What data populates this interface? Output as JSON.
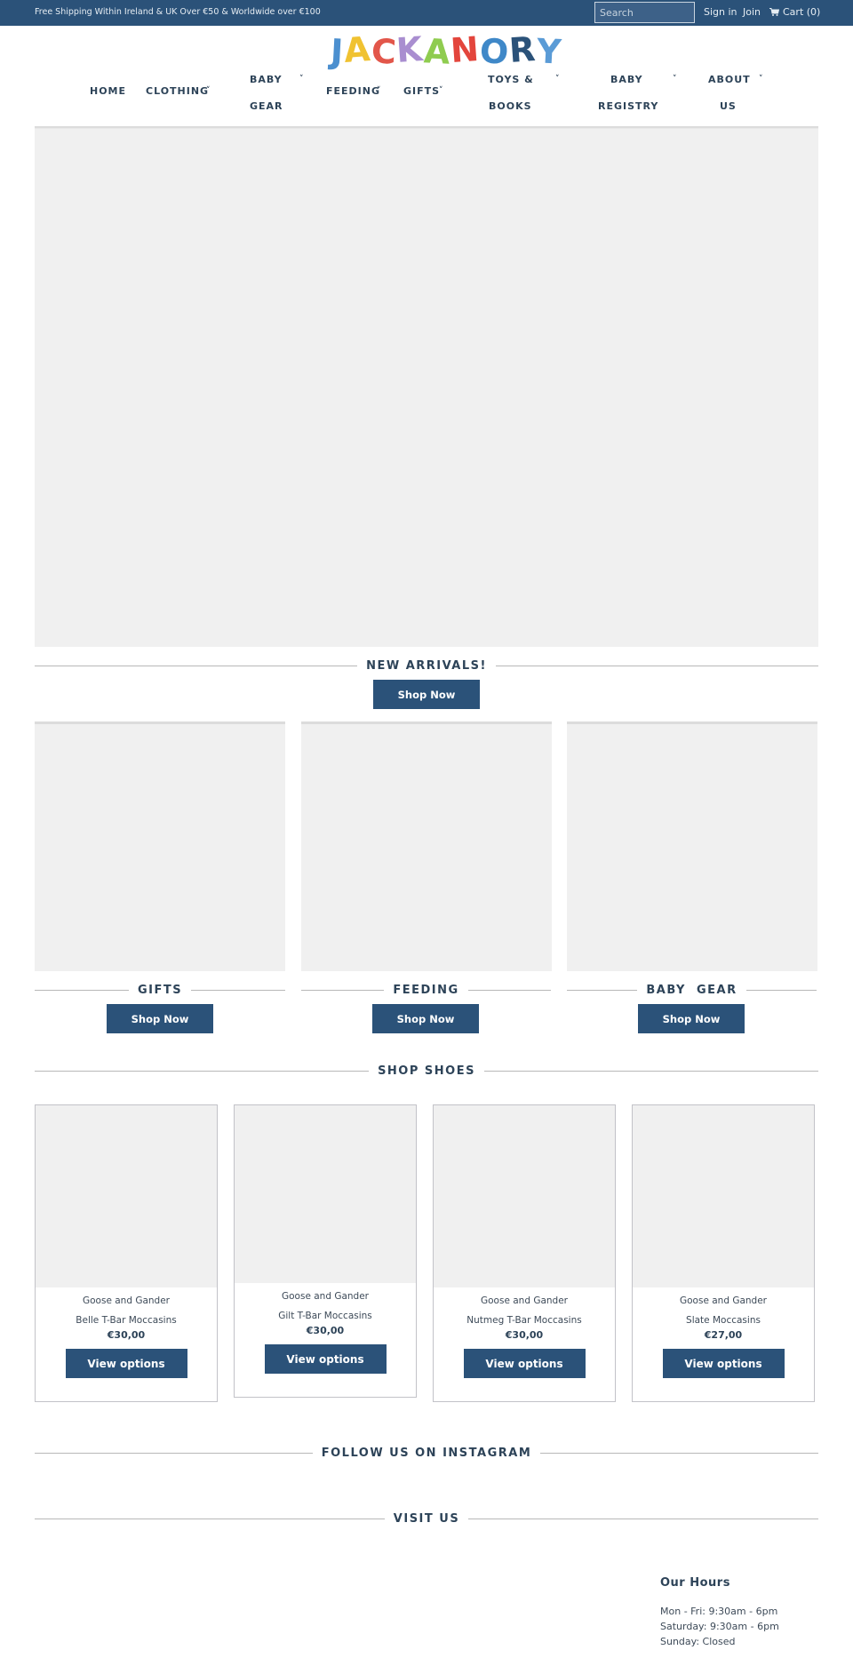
{
  "topbar": {
    "promo": "Free Shipping Within Ireland & UK Over €50 & Worldwide over €100",
    "search_placeholder": "Search",
    "sign_in": "Sign in",
    "join": "Join",
    "cart_icon": "cart-icon",
    "cart": "Cart (0)"
  },
  "colors": {
    "brand_blue": "#2b5279",
    "text_dark": "#2d4358",
    "placeholder_gray": "#f0f0f0"
  },
  "logo": {
    "text": "JACKANORY",
    "letters": [
      {
        "ch": "J",
        "color": "#4b8fcf"
      },
      {
        "ch": "A",
        "color": "#f0c231"
      },
      {
        "ch": "C",
        "color": "#e2564a"
      },
      {
        "ch": "K",
        "color": "#a98ed0"
      },
      {
        "ch": "A",
        "color": "#8fcc4f"
      },
      {
        "ch": "N",
        "color": "#e3453c"
      },
      {
        "ch": "O",
        "color": "#3f88c8"
      },
      {
        "ch": "R",
        "color": "#2b5279"
      },
      {
        "ch": "Y",
        "color": "#5a9bd6"
      }
    ]
  },
  "nav": {
    "items": [
      {
        "label": "HOME",
        "line2": "",
        "dropdown": false
      },
      {
        "label": "CLOTHING",
        "line2": "",
        "dropdown": true
      },
      {
        "label": "BABY",
        "line2": "GEAR",
        "dropdown": true
      },
      {
        "label": "FEEDING",
        "line2": "",
        "dropdown": true
      },
      {
        "label": "GIFTS",
        "line2": "",
        "dropdown": true
      },
      {
        "label": "TOYS &",
        "line2": "BOOKS",
        "dropdown": true
      },
      {
        "label": "BABY",
        "line2": "REGISTRY",
        "dropdown": true
      },
      {
        "label": "ABOUT",
        "line2": "US",
        "dropdown": true
      }
    ],
    "chevron": "˅"
  },
  "new_arrivals": {
    "title": "NEW ARRIVALS!",
    "button": "Shop Now"
  },
  "categories": [
    {
      "title": "GIFTS",
      "button": "Shop Now"
    },
    {
      "title": "FEEDING",
      "button": "Shop Now"
    },
    {
      "title": "BABY  GEAR",
      "button": "Shop Now"
    }
  ],
  "shop_shoes": {
    "title": "SHOP SHOES",
    "products": [
      {
        "brand": "Goose and Gander",
        "name": "Belle T-Bar Moccasins",
        "price": "€30,00",
        "button": "View options"
      },
      {
        "brand": "Goose and Gander",
        "name": "Gilt T-Bar Moccasins",
        "price": "€30,00",
        "button": "View options"
      },
      {
        "brand": "Goose and Gander",
        "name": "Nutmeg T-Bar Moccasins",
        "price": "€30,00",
        "button": "View options"
      },
      {
        "brand": "Goose and Gander",
        "name": "Slate Moccasins",
        "price": "€27,00",
        "button": "View options"
      }
    ]
  },
  "instagram": {
    "title": "FOLLOW US ON INSTAGRAM"
  },
  "visit": {
    "title": "VISIT US",
    "hours_title": "Our Hours",
    "hours": [
      "Mon - Fri: 9:30am - 6pm",
      "Saturday: 9:30am - 6pm",
      "Sunday: Closed"
    ]
  }
}
